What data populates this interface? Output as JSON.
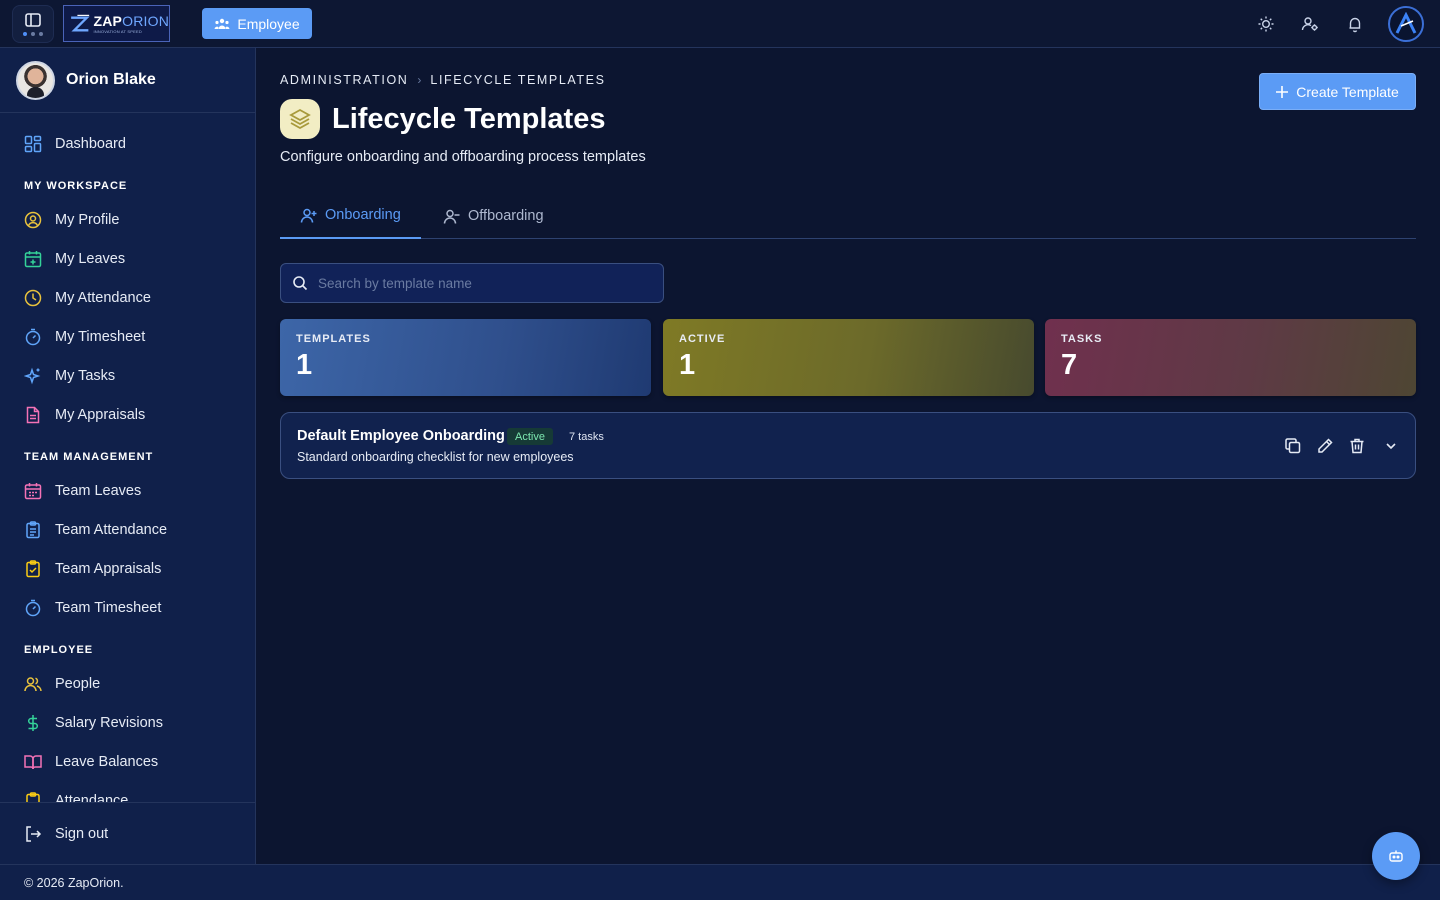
{
  "topbar": {
    "logo_word_a": "ZAP",
    "logo_word_b": "ORION",
    "logo_tagline": "INNOVATION AT SPEED",
    "role_label": "Employee",
    "icons": [
      "sun-icon",
      "user-gear-icon",
      "bell-icon"
    ]
  },
  "user": {
    "name": "Orion Blake"
  },
  "sidebar": {
    "dashboard": "Dashboard",
    "sections": {
      "my_workspace": "MY WORKSPACE",
      "team_management": "TEAM MANAGEMENT",
      "employee": "EMPLOYEE"
    },
    "my_workspace_items": [
      {
        "label": "My Profile",
        "icon": "user-circle-icon",
        "color": "#e8c23d"
      },
      {
        "label": "My Leaves",
        "icon": "calendar-plus-icon",
        "color": "#34d399"
      },
      {
        "label": "My Attendance",
        "icon": "clock-icon",
        "color": "#e8c23d"
      },
      {
        "label": "My Timesheet",
        "icon": "timer-icon",
        "color": "#60a5fa"
      },
      {
        "label": "My Tasks",
        "icon": "sparkles-icon",
        "color": "#60a5fa"
      },
      {
        "label": "My Appraisals",
        "icon": "document-icon",
        "color": "#f472b6"
      }
    ],
    "team_items": [
      {
        "label": "Team Leaves",
        "icon": "calendar-icon",
        "color": "#f472b6"
      },
      {
        "label": "Team Attendance",
        "icon": "clipboard-list-icon",
        "color": "#60a5fa"
      },
      {
        "label": "Team Appraisals",
        "icon": "clipboard-check-icon",
        "color": "#facc15"
      },
      {
        "label": "Team Timesheet",
        "icon": "timer-icon",
        "color": "#60a5fa"
      }
    ],
    "employee_items": [
      {
        "label": "People",
        "icon": "users-icon",
        "color": "#e8c23d"
      },
      {
        "label": "Salary Revisions",
        "icon": "dollar-icon",
        "color": "#34d399"
      },
      {
        "label": "Leave Balances",
        "icon": "book-open-icon",
        "color": "#f472b6"
      },
      {
        "label": "Attendance",
        "icon": "clipboard-icon",
        "color": "#facc15"
      }
    ],
    "sign_out": "Sign out"
  },
  "breadcrumb": [
    "ADMINISTRATION",
    "LIFECYCLE TEMPLATES"
  ],
  "page": {
    "title": "Lifecycle Templates",
    "subtitle": "Configure onboarding and offboarding process templates",
    "create_button": "Create Template"
  },
  "tabs": [
    {
      "label": "Onboarding",
      "active": true
    },
    {
      "label": "Offboarding",
      "active": false
    }
  ],
  "search": {
    "placeholder": "Search by template name",
    "value": ""
  },
  "stats": [
    {
      "label": "TEMPLATES",
      "value": "1"
    },
    {
      "label": "ACTIVE",
      "value": "1"
    },
    {
      "label": "TASKS",
      "value": "7"
    }
  ],
  "templates": [
    {
      "name": "Default Employee Onboarding",
      "status": "Active",
      "tasks": "7 tasks",
      "description": "Standard onboarding checklist for new employees"
    }
  ],
  "footer": {
    "copyright": "© 2026 ZapOrion."
  },
  "colors": {
    "accent": "#5b9bf5",
    "background": "#0c1530",
    "sidebar": "#10204a",
    "active_badge": "#7de8b0"
  }
}
